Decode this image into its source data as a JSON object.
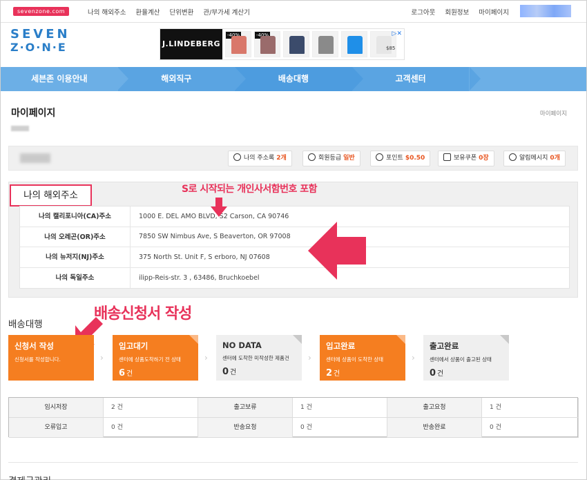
{
  "topbar": {
    "brand_badge": "sevenzone.com",
    "left_links": [
      "나의 해외주소",
      "환율계산",
      "단위변환",
      "관/부가세 계산기"
    ],
    "right_links": [
      "로그아웃",
      "회원정보",
      "마이페이지"
    ]
  },
  "header": {
    "logo_line1": "SEVEN",
    "logo_line2": "Z·O·N·E",
    "ad": {
      "brand": "J.LINDEBERG",
      "tags": [
        "-40%",
        "-40%"
      ],
      "price": "$85",
      "colors": [
        "#d9786b",
        "#9a6b6b",
        "#3b4b6b",
        "#8a8a8a",
        "#1f8fe8",
        "#e6e6e6"
      ]
    }
  },
  "nav": {
    "items": [
      "세븐존 이용안내",
      "해외직구",
      "배송대행",
      "고객센터",
      ""
    ]
  },
  "page": {
    "title": "마이페이지",
    "crumb": "마이페이지"
  },
  "infobar": {
    "pills": [
      {
        "label": "나의 주소록",
        "value": "2개"
      },
      {
        "label": "회원등급",
        "value": "일반"
      },
      {
        "label": "포인트",
        "value": "$0.50"
      },
      {
        "label": "보유쿠폰",
        "value": "0장"
      },
      {
        "label": "알림메시지",
        "value": "0개"
      }
    ]
  },
  "address": {
    "title": "나의 해외주소",
    "rows": [
      {
        "label": "나의 캘리포니아(CA)주소",
        "value": "1000 E. DEL AMO BLVD, S2   Carson, CA   90746"
      },
      {
        "label": "나의 오레곤(OR)주소",
        "value": "7850 SW Nimbus Ave, S     Beaverton, OR   97008"
      },
      {
        "label": "나의 뉴저지(NJ)주소",
        "value": "375 North St. Unit F, S        erboro, NJ   07608"
      },
      {
        "label": "나의 독일주소",
        "value": "        ilipp-Reis-str. 3 , 63486, Bruchkoebel"
      }
    ]
  },
  "annotations": {
    "note1": "S로 시작되는 개인사서함번호 포함",
    "note2": "배송신청서 작성",
    "color": "#e8325a"
  },
  "delivery": {
    "section_title": "배송대행",
    "steps": [
      {
        "title": "신청서 작성",
        "desc": "신청서를 작성합니다.",
        "count": "",
        "unit": "",
        "style": "orange"
      },
      {
        "title": "입고대기",
        "desc": "센터에 상품도착하기 전 상태",
        "count": "6",
        "unit": "건",
        "style": "orange"
      },
      {
        "title": "NO DATA",
        "desc": "센터에 도착한 미작성한 제품건",
        "count": "0",
        "unit": "건",
        "style": "gray"
      },
      {
        "title": "입고완료",
        "desc": "센터에 상품이 도착한 상태",
        "count": "2",
        "unit": "건",
        "style": "orange"
      },
      {
        "title": "출고완료",
        "desc": "센터에서 상품이 출고된 상태",
        "count": "0",
        "unit": "건",
        "style": "gray"
      }
    ]
  },
  "summary": {
    "cells": [
      {
        "k": "임시저장",
        "v": "2 건"
      },
      {
        "k": "출고보류",
        "v": "1 건"
      },
      {
        "k": "출고요청",
        "v": "1 건"
      },
      {
        "k": "오류입고",
        "v": "0 건"
      },
      {
        "k": "반송요청",
        "v": "0 건"
      },
      {
        "k": "반송완료",
        "v": "0 건"
      }
    ]
  },
  "next_section": "결제금관리"
}
